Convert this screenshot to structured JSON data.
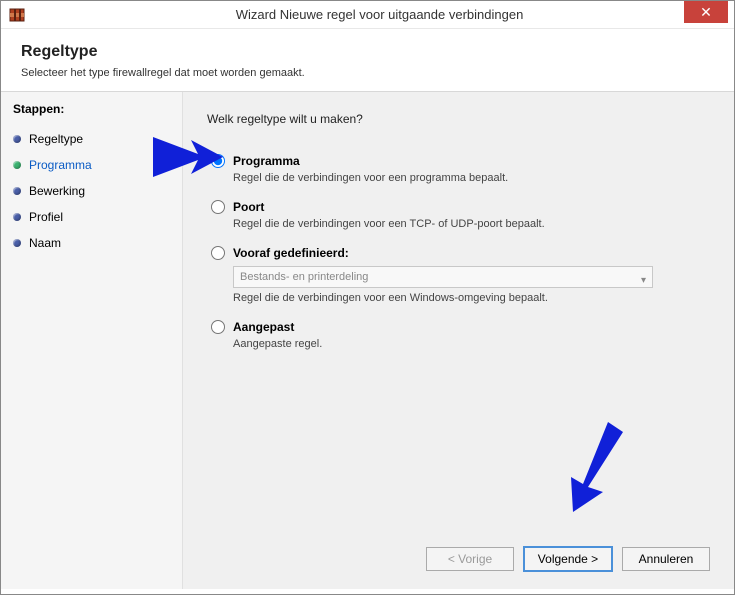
{
  "window": {
    "title": "Wizard Nieuwe regel voor uitgaande verbindingen",
    "close_glyph": "✕"
  },
  "header": {
    "title": "Regeltype",
    "subtitle": "Selecteer het type firewallregel dat moet worden gemaakt."
  },
  "sidebar": {
    "title": "Stappen:",
    "items": [
      {
        "label": "Regeltype"
      },
      {
        "label": "Programma"
      },
      {
        "label": "Bewerking"
      },
      {
        "label": "Profiel"
      },
      {
        "label": "Naam"
      }
    ]
  },
  "main": {
    "question": "Welk regeltype wilt u maken?",
    "options": {
      "programma": {
        "title": "Programma",
        "desc": "Regel die de verbindingen voor een programma bepaalt."
      },
      "poort": {
        "title": "Poort",
        "desc": "Regel die de verbindingen voor een TCP- of UDP-poort bepaalt."
      },
      "vooraf": {
        "title": "Vooraf gedefinieerd:",
        "select_value": "Bestands- en printerdeling",
        "desc": "Regel die de verbindingen voor een Windows-omgeving bepaalt."
      },
      "aangepast": {
        "title": "Aangepast",
        "desc": "Aangepaste regel."
      }
    }
  },
  "footer": {
    "back": "< Vorige",
    "next": "Volgende >",
    "cancel": "Annuleren"
  }
}
